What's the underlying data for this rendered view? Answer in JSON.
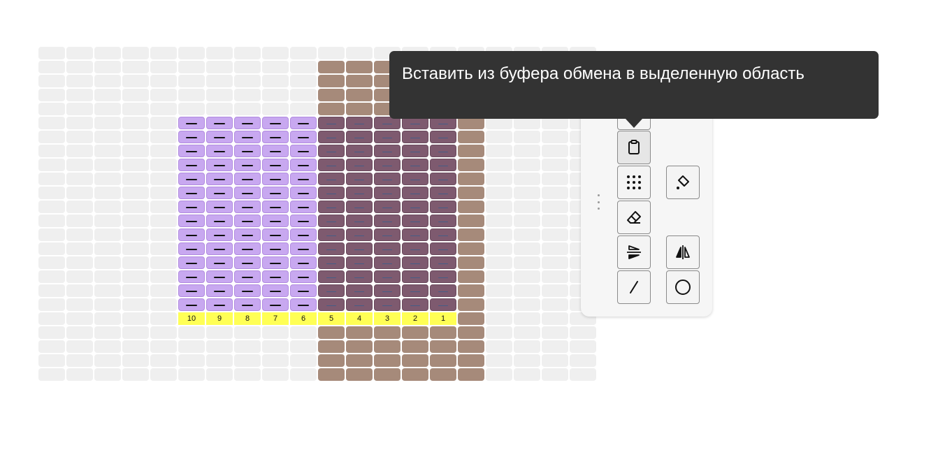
{
  "grid": {
    "columns": 20,
    "rows": 24,
    "row_numbers": [
      "10",
      "9",
      "8",
      "7",
      "6",
      "5",
      "4",
      "3",
      "2",
      "1"
    ],
    "colors": {
      "empty": "#efefef",
      "brown": "#a68a7a",
      "purple_selection": "#c8a8f0",
      "overlap": "#7e5a6f",
      "row_number_bar": "#ffff55",
      "stitch_symbol": "#111111"
    }
  },
  "toolbar": {
    "buttons": [
      {
        "name": "paste-button",
        "icon": "clipboard-icon",
        "state": "active"
      },
      {
        "name": "dot-pattern-button",
        "icon": "dot-grid-icon"
      },
      {
        "name": "fill-color-button",
        "icon": "paint-bucket-icon"
      },
      {
        "name": "eraser-button",
        "icon": "eraser-icon"
      },
      {
        "name": "flip-vertical-button",
        "icon": "flip-vertical-icon"
      },
      {
        "name": "flip-horizontal-button",
        "icon": "flip-horizontal-icon"
      },
      {
        "name": "line-tool-button",
        "icon": "line-icon"
      },
      {
        "name": "circle-tool-button",
        "icon": "circle-icon"
      }
    ]
  },
  "tooltip": {
    "text": "Вставить из буфера обмена в выделенную область"
  }
}
